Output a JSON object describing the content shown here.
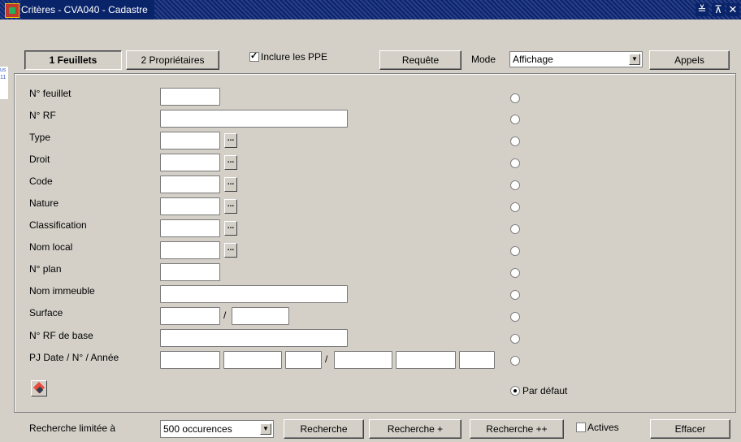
{
  "window": {
    "title": "Critères - CVA040 - Cadastre",
    "controls": [
      "≚",
      "⊼",
      "✕"
    ]
  },
  "left_strip": [
    "us",
    "11"
  ],
  "toolbar": {
    "tab1_label": "1 Feuillets",
    "tab2_label": "2 Propriétaires",
    "include_ppe_label": "Inclure les PPE",
    "include_ppe_checked": true,
    "requete_label": "Requête",
    "mode_label": "Mode",
    "mode_value": "Affichage",
    "appels_label": "Appels"
  },
  "fields": [
    {
      "label": "N° feuillet"
    },
    {
      "label": "N° RF"
    },
    {
      "label": "Type"
    },
    {
      "label": "Droit"
    },
    {
      "label": "Code"
    },
    {
      "label": "Nature"
    },
    {
      "label": "Classification"
    },
    {
      "label": "Nom local"
    },
    {
      "label": "N° plan"
    },
    {
      "label": "Nom immeuble"
    },
    {
      "label": "Surface"
    },
    {
      "label": "N° RF de base"
    },
    {
      "label": "PJ Date / N° / Année"
    }
  ],
  "lov_button_label": "...",
  "separator": "/",
  "par_defaut_label": "Par défaut",
  "footer": {
    "limit_label": "Recherche limitée à",
    "limit_value": "500 occurences",
    "recherche_label": "Recherche",
    "recherche_plus_label": "Recherche +",
    "recherche_plusplus_label": "Recherche ++",
    "actives_label": "Actives",
    "actives_checked": false,
    "effacer_label": "Effacer"
  },
  "colors": {
    "titlebar": "#0a246a",
    "window_bg": "#d4d0c8"
  }
}
